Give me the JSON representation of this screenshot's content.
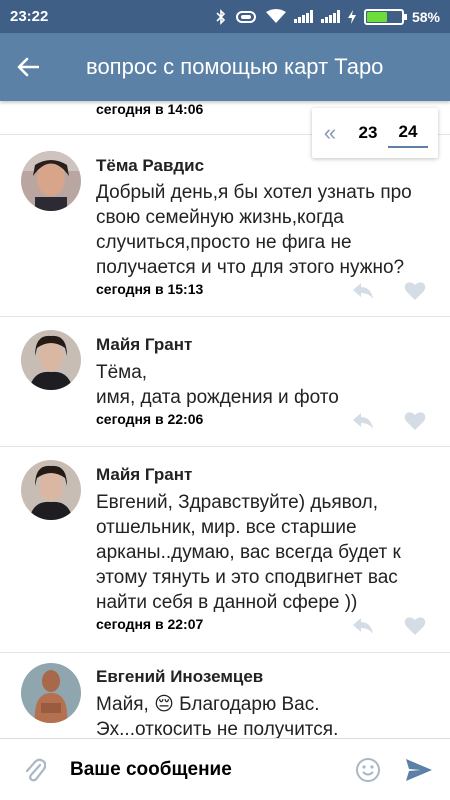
{
  "status_bar": {
    "time": "23:22",
    "battery_pct": "58%",
    "battery_level": 0.58
  },
  "header": {
    "title": "вопрос с помощью карт Таро"
  },
  "pager": {
    "prev_icon": "double-chevron-left-icon",
    "pages": [
      "23",
      "24"
    ],
    "active": "24"
  },
  "messages": [
    {
      "author": "",
      "text": "",
      "time": "сегодня в 14:06"
    },
    {
      "author": "Тёма Равдис",
      "text_lines": [
        "Добрый день,я бы хотел узнать про",
        "свою семейную жизнь,когда",
        "случиться,просто не фига не",
        "получается и что для этого нужно?"
      ],
      "time": "сегодня в 15:13"
    },
    {
      "author": "Майя Грант",
      "text_lines": [
        "Тёма,",
        "имя, дата рождения и фото"
      ],
      "time": "сегодня в 22:06"
    },
    {
      "author": "Майя Грант",
      "text_lines": [
        "Евгений, Здравствуйте) дьявол,",
        "отшельник, мир. все старшие",
        "арканы..думаю, вас всегда будет к",
        "этому тянуть и это сподвигнет вас",
        "найти себя в данной сфере ))"
      ],
      "time": "сегодня в 22:07"
    },
    {
      "author": "Евгений Иноземцев",
      "text_lines": [
        "Майя, 😔 Благодарю Вас.",
        "Эх...откосить не получится."
      ],
      "time": ""
    }
  ],
  "composer": {
    "placeholder": "Ваше сообщение"
  },
  "colors": {
    "status_bar": "#3f5f86",
    "app_bar": "#5b81a7",
    "accent": "#5b81a7",
    "icon_gray": "#c9d2dc"
  }
}
